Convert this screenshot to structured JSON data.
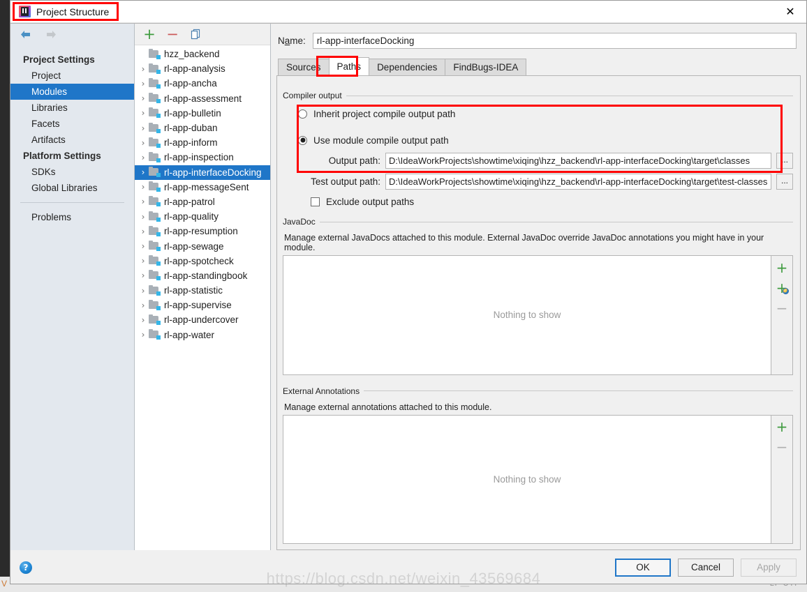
{
  "window": {
    "title": "Project Structure",
    "app_icon": "intellij-idea-icon",
    "close_label": "✕"
  },
  "background_ide": {
    "status_left": "V",
    "status_right": "LF    UTF"
  },
  "nav": {
    "back_icon": "arrow-left-icon",
    "forward_icon": "arrow-right-icon"
  },
  "sidebar": {
    "groups": [
      {
        "header": "Project Settings",
        "items": [
          {
            "label": "Project",
            "selected": false
          },
          {
            "label": "Modules",
            "selected": true
          },
          {
            "label": "Libraries",
            "selected": false
          },
          {
            "label": "Facets",
            "selected": false
          },
          {
            "label": "Artifacts",
            "selected": false
          }
        ]
      },
      {
        "header": "Platform Settings",
        "items": [
          {
            "label": "SDKs",
            "selected": false
          },
          {
            "label": "Global Libraries",
            "selected": false
          }
        ]
      }
    ],
    "footer_items": [
      {
        "label": "Problems",
        "selected": false
      }
    ]
  },
  "modules_panel": {
    "toolbar": [
      {
        "name": "add-module-button",
        "glyph": "+",
        "kind": "plus"
      },
      {
        "name": "remove-module-button",
        "glyph": "−",
        "kind": "minus"
      },
      {
        "name": "copy-module-button",
        "glyph": "",
        "kind": "copy"
      }
    ],
    "items": [
      {
        "label": "hzz_backend",
        "expandable": false,
        "selected": false
      },
      {
        "label": "rl-app-analysis",
        "expandable": true,
        "selected": false
      },
      {
        "label": "rl-app-ancha",
        "expandable": true,
        "selected": false
      },
      {
        "label": "rl-app-assessment",
        "expandable": true,
        "selected": false
      },
      {
        "label": "rl-app-bulletin",
        "expandable": true,
        "selected": false
      },
      {
        "label": "rl-app-duban",
        "expandable": true,
        "selected": false
      },
      {
        "label": "rl-app-inform",
        "expandable": true,
        "selected": false
      },
      {
        "label": "rl-app-inspection",
        "expandable": true,
        "selected": false
      },
      {
        "label": "rl-app-interfaceDocking",
        "expandable": true,
        "selected": true
      },
      {
        "label": "rl-app-messageSent",
        "expandable": true,
        "selected": false
      },
      {
        "label": "rl-app-patrol",
        "expandable": true,
        "selected": false
      },
      {
        "label": "rl-app-quality",
        "expandable": true,
        "selected": false
      },
      {
        "label": "rl-app-resumption",
        "expandable": true,
        "selected": false
      },
      {
        "label": "rl-app-sewage",
        "expandable": true,
        "selected": false
      },
      {
        "label": "rl-app-spotcheck",
        "expandable": true,
        "selected": false
      },
      {
        "label": "rl-app-standingbook",
        "expandable": true,
        "selected": false
      },
      {
        "label": "rl-app-statistic",
        "expandable": true,
        "selected": false
      },
      {
        "label": "rl-app-supervise",
        "expandable": true,
        "selected": false
      },
      {
        "label": "rl-app-undercover",
        "expandable": true,
        "selected": false
      },
      {
        "label": "rl-app-water",
        "expandable": true,
        "selected": false
      }
    ]
  },
  "module_editor": {
    "name_label": "Name:",
    "name_value": "rl-app-interfaceDocking",
    "tabs": [
      {
        "label": "Sources",
        "active": false
      },
      {
        "label": "Paths",
        "active": true
      },
      {
        "label": "Dependencies",
        "active": false
      },
      {
        "label": "FindBugs-IDEA",
        "active": false
      }
    ],
    "compiler_output": {
      "section_title": "Compiler output",
      "inherit_option": "Inherit project compile output path",
      "inherit_selected": false,
      "module_option": "Use module compile output path",
      "module_selected": true,
      "output_path_label": "Output path:",
      "output_path_value": "D:\\IdeaWorkProjects\\showtime\\xiqing\\hzz_backend\\rl-app-interfaceDocking\\target\\classes",
      "test_output_path_label": "Test output path:",
      "test_output_path_value": "D:\\IdeaWorkProjects\\showtime\\xiqing\\hzz_backend\\rl-app-interfaceDocking\\target\\test-classes",
      "browse_label": "...",
      "exclude_label": "Exclude output paths",
      "exclude_checked": false
    },
    "javadoc": {
      "section_title": "JavaDoc",
      "description": "Manage external JavaDocs attached to this module. External JavaDoc override JavaDoc annotations you might have in your module.",
      "empty_text": "Nothing to show",
      "actions": [
        {
          "name": "javadoc-add-button",
          "glyph": "+",
          "kind": "plus",
          "enabled": true
        },
        {
          "name": "javadoc-add-url-button",
          "glyph": "+",
          "kind": "plus-globe",
          "enabled": true
        },
        {
          "name": "javadoc-remove-button",
          "glyph": "−",
          "kind": "minus",
          "enabled": false
        }
      ]
    },
    "external_annotations": {
      "section_title": "External Annotations",
      "description": "Manage external annotations attached to this module.",
      "empty_text": "Nothing to show",
      "actions": [
        {
          "name": "annotations-add-button",
          "glyph": "+",
          "kind": "plus",
          "enabled": true
        },
        {
          "name": "annotations-remove-button",
          "glyph": "−",
          "kind": "minus",
          "enabled": false
        }
      ]
    }
  },
  "footer": {
    "help_label": "?",
    "ok_label": "OK",
    "cancel_label": "Cancel",
    "apply_label": "Apply",
    "apply_enabled": false
  },
  "watermark": {
    "text": "https://blog.csdn.net/weixin_43569684"
  },
  "colors": {
    "accent_selection": "#1f76c8",
    "annotation_red": "#ff0000",
    "add_green": "#3f9b3f",
    "remove_red": "#cc5b5b",
    "module_badge": "#35b6e8"
  }
}
